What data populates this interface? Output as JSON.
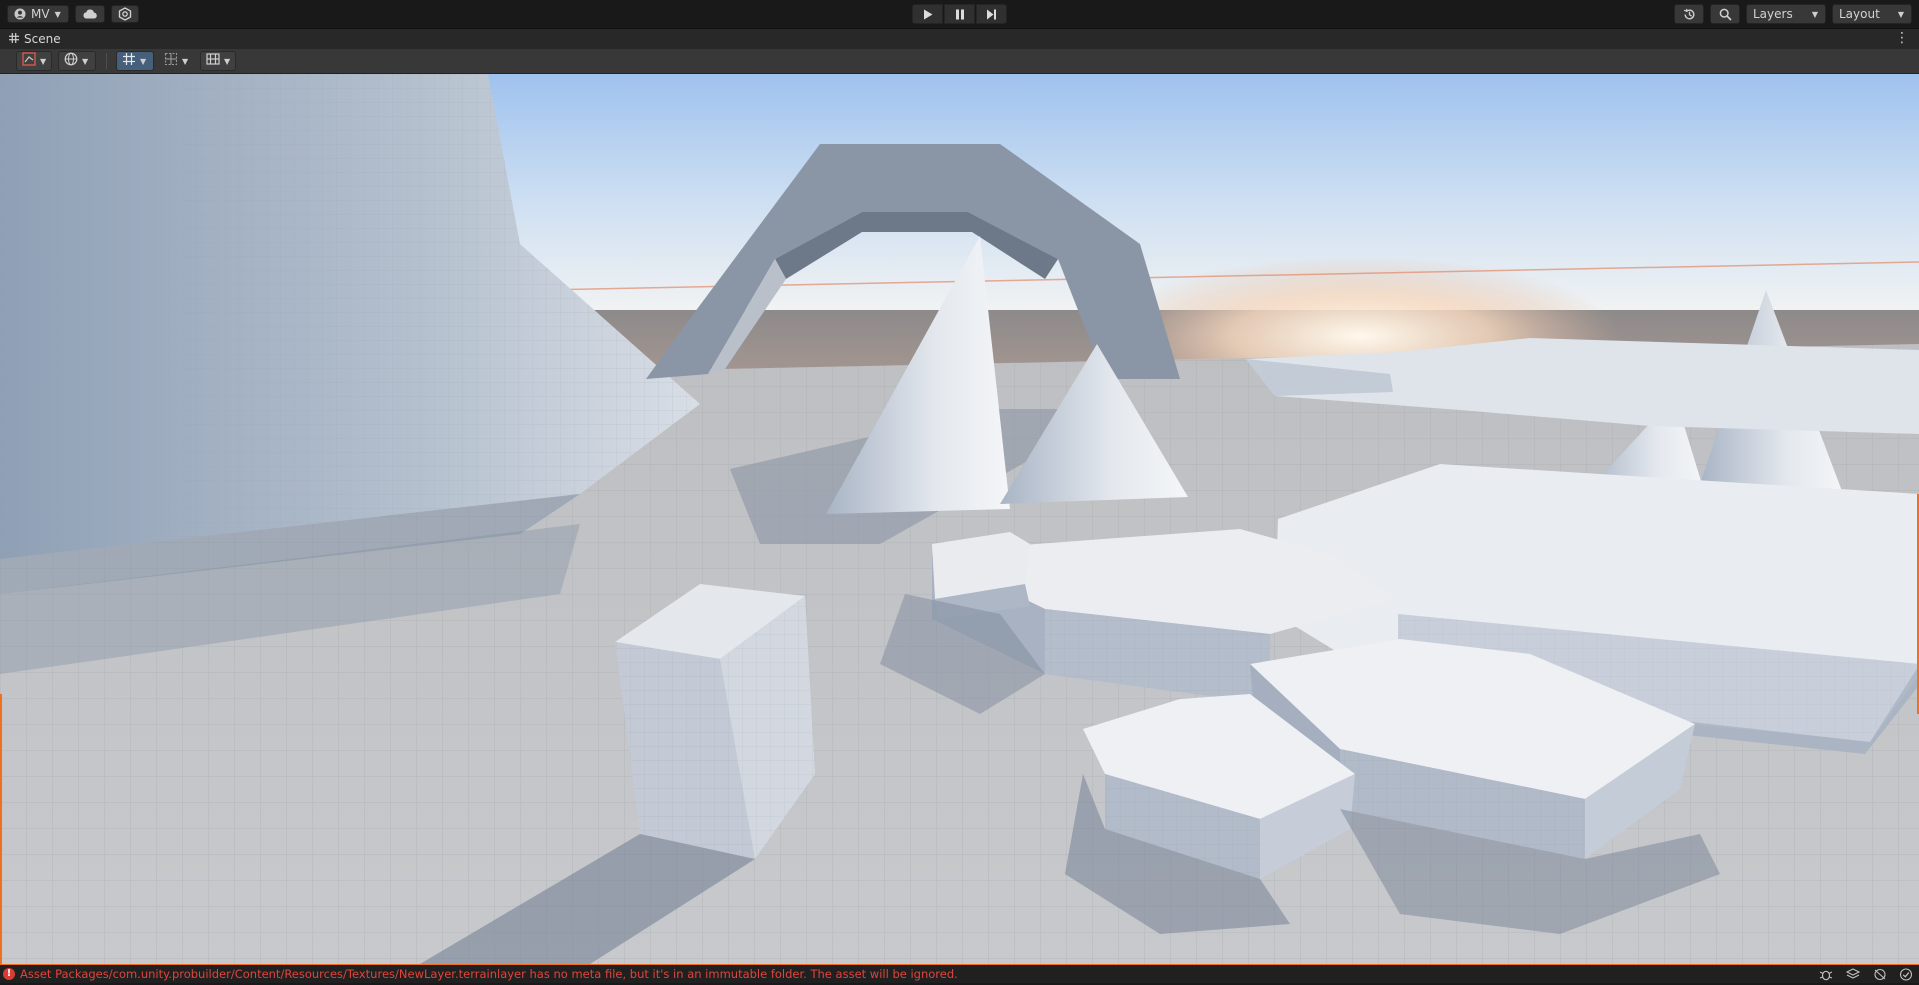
{
  "topbar": {
    "account_label": "MV",
    "layers_label": "Layers",
    "layout_label": "Layout",
    "icons": [
      "account-icon",
      "cloud-icon",
      "collab-icon",
      "play-icon",
      "pause-icon",
      "step-icon",
      "history-icon",
      "search-icon"
    ]
  },
  "tab": {
    "title": "Scene",
    "icon": "grid-icon"
  },
  "scene_toolbar": {
    "tools": [
      "draw-mode-icon",
      "render-globe-icon",
      "grid-snap-icon",
      "gizmo-icon",
      "layout-tools-icon"
    ]
  },
  "status": {
    "message": "Asset Packages/com.unity.probuilder/Content/Resources/Textures/NewLayer.terrainlayer has no meta file, but it's in an immutable folder. The asset will be ignored.",
    "error_color": "#e0443c",
    "accent_border": "#f07020"
  }
}
